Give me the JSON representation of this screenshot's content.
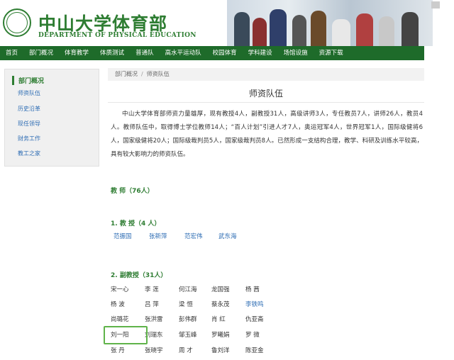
{
  "header": {
    "logo_title": "中山大学体育部",
    "logo_subtitle": "DEPARTMENT OF PHYSICAL EDUCATION"
  },
  "nav": [
    "首页",
    "部门概况",
    "体育教学",
    "体质测试",
    "普通队",
    "高水平运动队",
    "校园体育",
    "学科建设",
    "场馆设施",
    "资源下载"
  ],
  "sidebar": {
    "heading": "部门概况",
    "links": [
      "师资队伍",
      "历史沿革",
      "现任领导",
      "财务工作",
      "教工之家"
    ]
  },
  "breadcrumb": [
    "部门概况",
    "师资队伍"
  ],
  "page_title": "师资队伍",
  "intro": "中山大学体育部师资力量雄厚，现有教授4人，副教授31人，高级讲师3人，专任教员7人，讲师26人，教员4人。教师队伍中，取得博士学位教师14人；“百人计划”引进人才7人，奥运冠军4人，世界冠军1人，国际级健将6人，国家级健将20人；国际级裁判员5人，国家级裁判员8人。已然形成一支结构合理，教学、科研及训练水平较高，具有较大影响力的师资队伍。",
  "teachers": {
    "heading": "教 师（76人）",
    "professors": {
      "heading": "1. 教 授（4 人）",
      "names": [
        "范振国",
        "张新萍",
        "范宏伟",
        "武东海"
      ]
    },
    "associate_professors": {
      "heading": "2. 副教授（31人）",
      "rows": [
        [
          "宋一心",
          "李 莲",
          "何江海",
          "龙国强",
          "杨 茜"
        ],
        [
          "杨 波",
          "吕 萍",
          "梁 恒",
          "蔡永茂",
          "李铁鸣"
        ],
        [
          "尚璐花",
          "张洪雷",
          "彭伟群",
          "肖 红",
          "仇亚斋"
        ],
        [
          "刘一阳",
          "刘瑞东",
          "邹玉峰",
          "罗曦娟",
          "罗 微"
        ],
        [
          "张 丹",
          "张晓宇",
          "周 才",
          "鲁刘洋",
          "陈亚金"
        ]
      ]
    }
  }
}
